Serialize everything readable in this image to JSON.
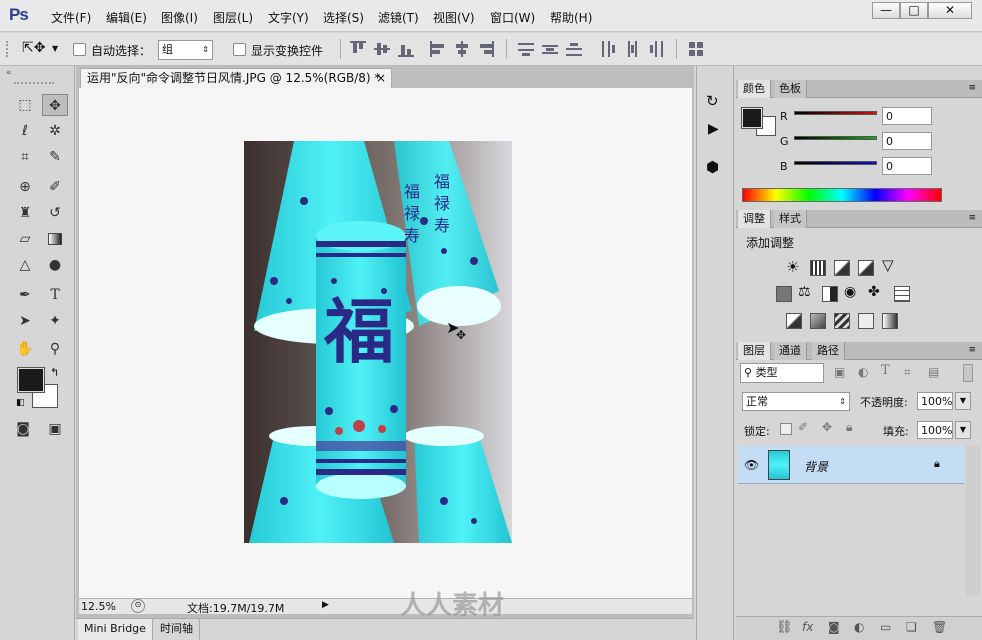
{
  "menubar": {
    "logo": "Ps",
    "items": [
      "文件(F)",
      "编辑(E)",
      "图像(I)",
      "图层(L)",
      "文字(Y)",
      "选择(S)",
      "滤镜(T)",
      "视图(V)",
      "窗口(W)",
      "帮助(H)"
    ],
    "window_buttons": [
      "—",
      "□",
      "✕"
    ]
  },
  "options": {
    "tool_icon": "move-icon",
    "auto_select_label": "自动选择：",
    "auto_select_value": "组",
    "show_transform_label": "显示变换控件"
  },
  "document": {
    "tab_title": "运用\"反向\"命令调整节日风情.JPG @ 12.5%(RGB/8) *",
    "tab_close": "×",
    "zoom": "12.5%",
    "doc_info": "文档:19.7M/19.7M"
  },
  "bottom_tabs": [
    "Mini Bridge",
    "时间轴"
  ],
  "color_panel": {
    "tabs": [
      "颜色",
      "色板"
    ],
    "channels": [
      {
        "label": "R",
        "value": "0",
        "color": "#d01010"
      },
      {
        "label": "G",
        "value": "0",
        "color": "#10b010"
      },
      {
        "label": "B",
        "value": "0",
        "color": "#1010c0"
      }
    ]
  },
  "adjust_panel": {
    "tabs": [
      "调整",
      "样式"
    ],
    "title": "添加调整"
  },
  "layers_panel": {
    "tabs": [
      "图层",
      "通道",
      "路径"
    ],
    "filter_label": "类型",
    "blend_mode": "正常",
    "opacity_label": "不透明度:",
    "opacity_value": "100%",
    "lock_label": "锁定:",
    "fill_label": "填充:",
    "fill_value": "100%",
    "layer_name": "背景"
  },
  "photo": {
    "character": "福",
    "decor_chars": [
      "福",
      "禄",
      "寿",
      "福",
      "禄",
      "寿"
    ]
  },
  "watermark": "人人素材",
  "colors": {
    "brand": "#2e3f8e",
    "cyan": "#27e6ee",
    "navy": "#2a2a86",
    "layer_highlight": "#c4dcf4"
  }
}
